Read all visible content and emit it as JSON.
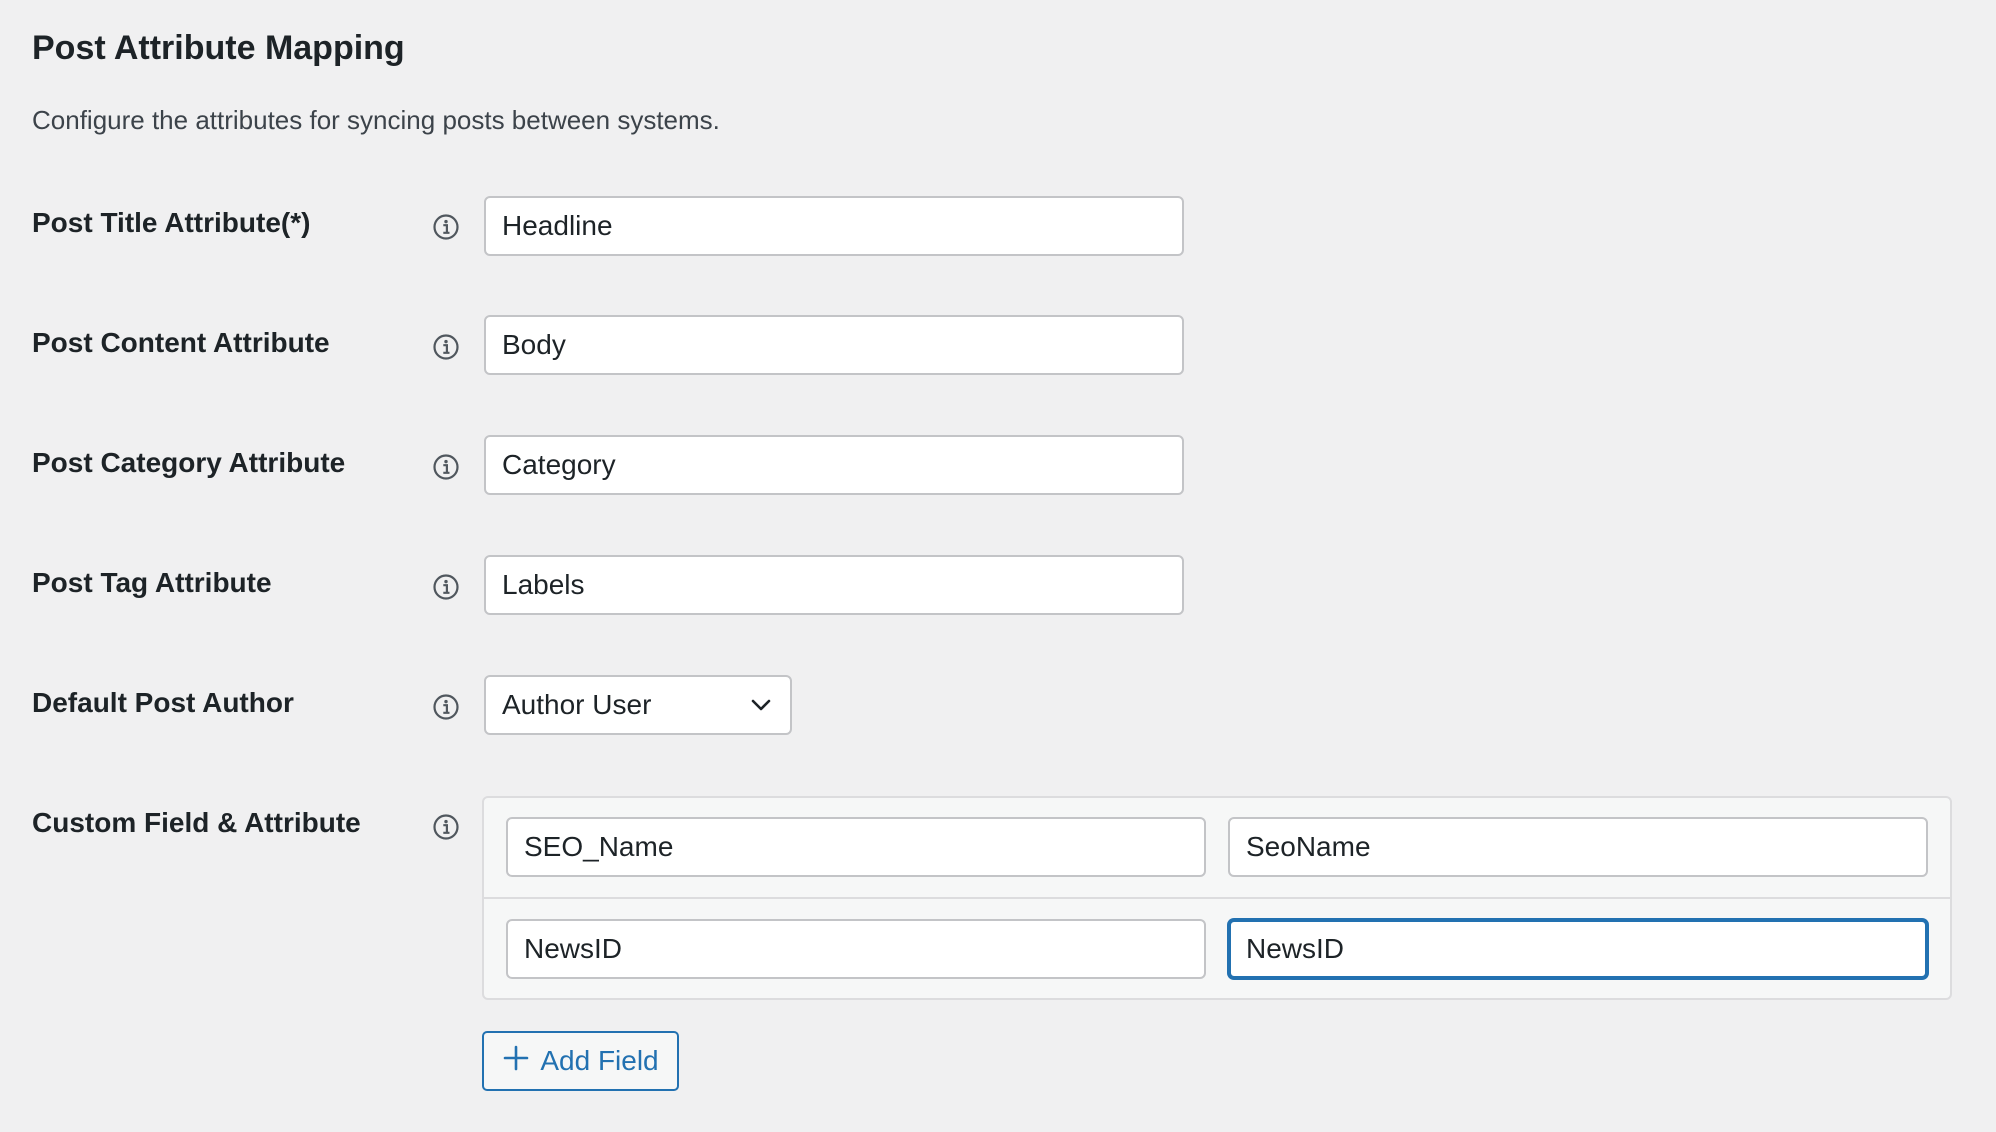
{
  "section": {
    "title": "Post Attribute Mapping",
    "description": "Configure the attributes for syncing posts between systems."
  },
  "fields": {
    "post_title": {
      "label": "Post Title Attribute(*)",
      "value": "Headline"
    },
    "post_content": {
      "label": "Post Content Attribute",
      "value": "Body"
    },
    "post_category": {
      "label": "Post Category Attribute",
      "value": "Category"
    },
    "post_tag": {
      "label": "Post Tag Attribute",
      "value": "Labels"
    },
    "default_author": {
      "label": "Default Post Author",
      "selected": "Author User"
    },
    "custom_fields": {
      "label": "Custom Field & Attribute",
      "rows": [
        {
          "field": "SEO_Name",
          "attribute": "SeoName"
        },
        {
          "field": "NewsID",
          "attribute": "NewsID"
        }
      ]
    }
  },
  "add_field_button": {
    "label": "Add Field"
  },
  "icons": {
    "info": "info-circle-icon",
    "chevron": "chevron-down-icon",
    "plus": "plus-icon"
  },
  "colors": {
    "background": "#f0f0f1",
    "accent": "#2271b1",
    "border": "#c3c4c7"
  }
}
